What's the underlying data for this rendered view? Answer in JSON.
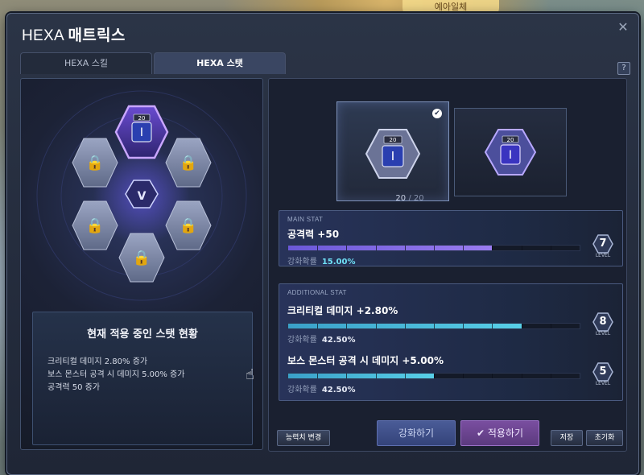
{
  "background_tag": "예아일체",
  "window": {
    "title_prefix": "HEXA",
    "title_main": "매트릭스",
    "close_symbol": "✕",
    "help_symbol": "?"
  },
  "tabs": [
    {
      "label": "HEXA 스킬",
      "active": false
    },
    {
      "label": "HEXA 스탯",
      "active": true
    }
  ],
  "hex_grid": {
    "active_core_level": "20",
    "center_symbol": "V",
    "locked_slots": 5
  },
  "summary": {
    "title": "현재 적용 중인 스탯 현황",
    "lines": [
      "크리티컬 데미지 2.80% 증가",
      "보스 몬스터 공격 시 데미지 5.00% 증가",
      "공격력 50 증가"
    ]
  },
  "cards": {
    "current": {
      "level": "20",
      "selected": true
    },
    "next": {
      "level": "20"
    },
    "progress_current": "20",
    "progress_max": "20",
    "progress_separator": "/"
  },
  "main_stat": {
    "section": "MAIN STAT",
    "name": "공격력 +50",
    "rate_label": "강화확률",
    "rate": "15.00%",
    "progress": 0.7,
    "level": "7",
    "level_label": "LEVEL"
  },
  "additional_stat": {
    "section": "ADDITIONAL STAT",
    "stats": [
      {
        "name": "크리티컬 데미지 +2.80%",
        "rate_label": "강화확률",
        "rate": "42.50%",
        "progress": 0.8,
        "level": "8",
        "level_label": "LEVEL"
      },
      {
        "name": "보스 몬스터 공격 시 데미지 +5.00%",
        "rate_label": "강화확률",
        "rate": "42.50%",
        "progress": 0.5,
        "level": "5",
        "level_label": "LEVEL"
      }
    ]
  },
  "buttons": {
    "change_stat": "능력치 변경",
    "enhance": "강화하기",
    "apply": "적용하기",
    "apply_icon": "check-circle-icon",
    "save": "저장",
    "reset": "초기화"
  },
  "colors": {
    "accent_purple": "#7b62e0",
    "accent_cyan": "#4cc4e0",
    "active_hex": "#8a66d8"
  }
}
